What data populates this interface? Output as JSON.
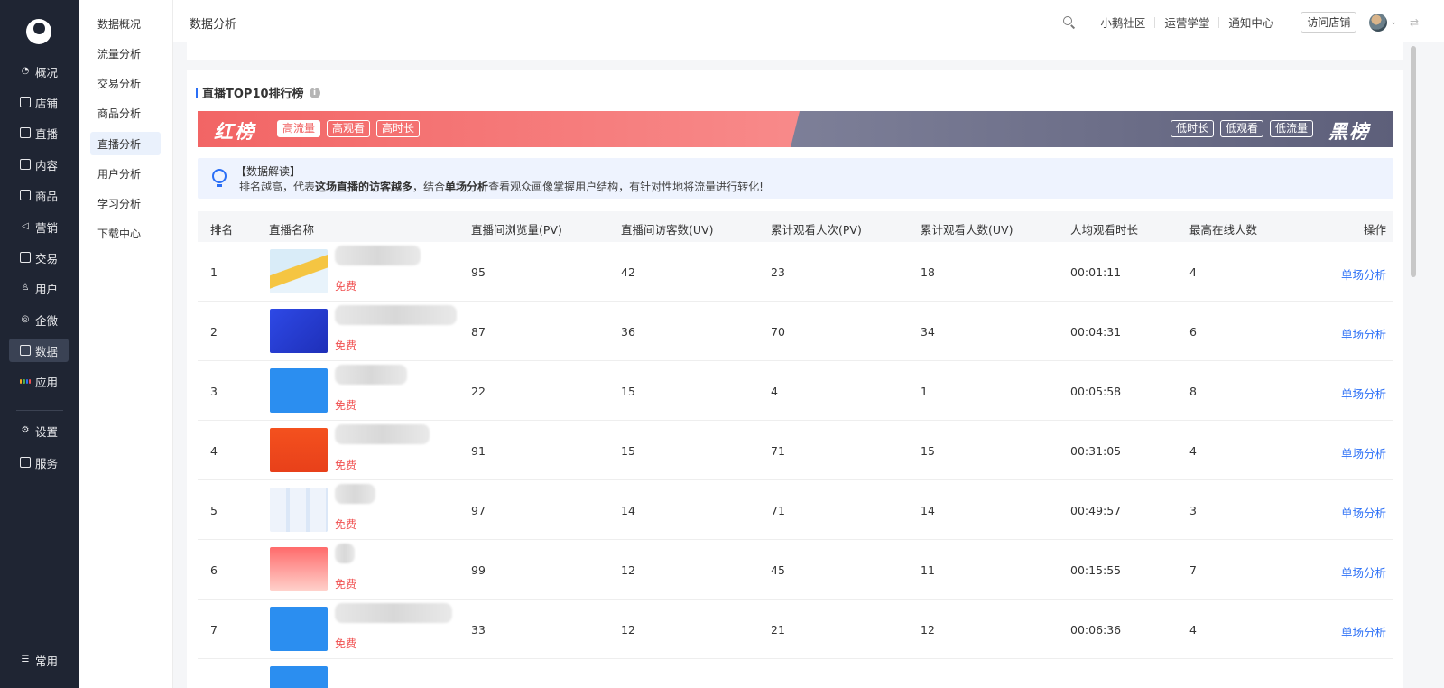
{
  "nav": {
    "items": [
      {
        "label": "概况",
        "icon": "pie-chart-icon"
      },
      {
        "label": "店铺",
        "icon": "store-icon"
      },
      {
        "label": "直播",
        "icon": "live-icon"
      },
      {
        "label": "内容",
        "icon": "document-icon"
      },
      {
        "label": "商品",
        "icon": "goods-icon"
      },
      {
        "label": "营销",
        "icon": "megaphone-icon"
      },
      {
        "label": "交易",
        "icon": "trade-icon"
      },
      {
        "label": "用户",
        "icon": "user-icon"
      },
      {
        "label": "企微",
        "icon": "chat-icon"
      },
      {
        "label": "数据",
        "icon": "data-icon"
      },
      {
        "label": "应用",
        "icon": "apps-icon"
      },
      {
        "label": "设置",
        "icon": "gear-icon"
      },
      {
        "label": "服务",
        "icon": "service-icon"
      }
    ],
    "bottom_label": "常用"
  },
  "submenu": {
    "items": [
      "数据概况",
      "流量分析",
      "交易分析",
      "商品分析",
      "直播分析",
      "用户分析",
      "学习分析",
      "下载中心"
    ]
  },
  "topbar": {
    "title": "数据分析",
    "links": [
      "小鹅社区",
      "运营学堂",
      "通知中心"
    ],
    "visit_store": "访问店铺"
  },
  "section": {
    "title": "直播TOP10排行榜",
    "red_label": "红榜",
    "red_tags": [
      "高流量",
      "高观看",
      "高时长"
    ],
    "black_label": "黑榜",
    "black_tags": [
      "低时长",
      "低观看",
      "低流量"
    ],
    "tip_head": "【数据解读】",
    "tip_1": "排名越高，代表",
    "tip_2": "这场直播的访客越多",
    "tip_3": "，结合",
    "tip_4": "单场分析",
    "tip_5": "查看观众画像掌握用户结构，有针对性地将流量进行转化!"
  },
  "table": {
    "headers": [
      "排名",
      "直播名称",
      "直播间浏览量(PV)",
      "直播间访客数(UV)",
      "累计观看人次(PV)",
      "累计观看人数(UV)",
      "人均观看时长",
      "最高在线人数",
      "操作"
    ],
    "rows": [
      {
        "rank": "1",
        "price": "免费",
        "pv": "95",
        "uv": "42",
        "watch_pv": "23",
        "watch_uv": "18",
        "avg": "00:01:11",
        "peak": "4",
        "op": "单场分析"
      },
      {
        "rank": "2",
        "price": "免费",
        "pv": "87",
        "uv": "36",
        "watch_pv": "70",
        "watch_uv": "34",
        "avg": "00:04:31",
        "peak": "6",
        "op": "单场分析"
      },
      {
        "rank": "3",
        "price": "免费",
        "pv": "22",
        "uv": "15",
        "watch_pv": "4",
        "watch_uv": "1",
        "avg": "00:05:58",
        "peak": "8",
        "op": "单场分析"
      },
      {
        "rank": "4",
        "price": "免费",
        "pv": "91",
        "uv": "15",
        "watch_pv": "71",
        "watch_uv": "15",
        "avg": "00:31:05",
        "peak": "4",
        "op": "单场分析"
      },
      {
        "rank": "5",
        "price": "免费",
        "pv": "97",
        "uv": "14",
        "watch_pv": "71",
        "watch_uv": "14",
        "avg": "00:49:57",
        "peak": "3",
        "op": "单场分析"
      },
      {
        "rank": "6",
        "price": "免费",
        "pv": "99",
        "uv": "12",
        "watch_pv": "45",
        "watch_uv": "11",
        "avg": "00:15:55",
        "peak": "7",
        "op": "单场分析"
      },
      {
        "rank": "7",
        "price": "免费",
        "pv": "33",
        "uv": "12",
        "watch_pv": "21",
        "watch_uv": "12",
        "avg": "00:06:36",
        "peak": "4",
        "op": "单场分析"
      }
    ]
  },
  "colors": {
    "accent": "#2b6ff6",
    "red_banner": "#f26565",
    "black_banner": "#6b6d88",
    "free": "#f05050",
    "nav_bg": "#1f2533"
  }
}
